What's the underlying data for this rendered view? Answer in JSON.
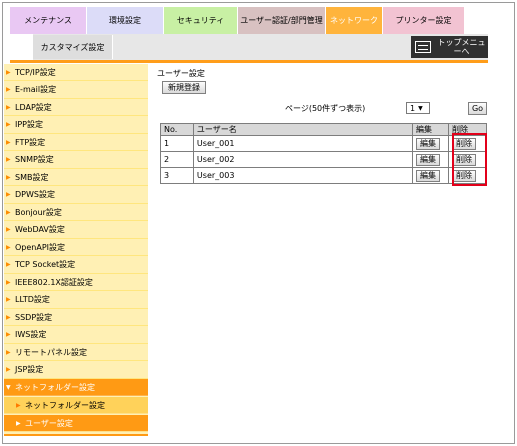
{
  "tabs": {
    "maintenance": "メンテナンス",
    "environment": "環境設定",
    "security": "セキュリティ",
    "auth": "ユーザー認証/部門管理",
    "network": "ネットワーク",
    "printer": "プリンター設定",
    "customize": "カスタマイズ設定"
  },
  "top_menu": {
    "label": "トップメニューへ",
    "icon": "menu-list-icon"
  },
  "sidebar": {
    "items": [
      {
        "label": "TCP/IP設定"
      },
      {
        "label": "E-mail設定"
      },
      {
        "label": "LDAP設定"
      },
      {
        "label": "IPP設定"
      },
      {
        "label": "FTP設定"
      },
      {
        "label": "SNMP設定"
      },
      {
        "label": "SMB設定"
      },
      {
        "label": "DPWS設定"
      },
      {
        "label": "Bonjour設定"
      },
      {
        "label": "WebDAV設定"
      },
      {
        "label": "OpenAPI設定"
      },
      {
        "label": "TCP Socket設定"
      },
      {
        "label": "IEEE802.1X認証設定"
      },
      {
        "label": "LLTD設定"
      },
      {
        "label": "SSDP設定"
      },
      {
        "label": "IWS設定"
      },
      {
        "label": "リモートパネル設定"
      },
      {
        "label": "JSP設定"
      }
    ],
    "group": {
      "label": "ネットフォルダー設定"
    },
    "sub_items": [
      {
        "label": "ネットフォルダー設定"
      },
      {
        "label": "ユーザー設定"
      }
    ]
  },
  "main": {
    "title": "ユーザー設定",
    "register_button": "新規登録",
    "pager_label": "ページ(50件ずつ表示)",
    "page_select": "1",
    "go_button": "Go",
    "table": {
      "headers": [
        "No.",
        "ユーザー名",
        "編集",
        "削除"
      ],
      "rows": [
        {
          "no": "1",
          "name": "User_001",
          "edit": "編集",
          "delete": "削除"
        },
        {
          "no": "2",
          "name": "User_002",
          "edit": "編集",
          "delete": "削除"
        },
        {
          "no": "3",
          "name": "User_003",
          "edit": "編集",
          "delete": "削除"
        }
      ]
    }
  },
  "colors": {
    "accent": "#ff9a14",
    "sidebar_bg": "#fff0b4",
    "highlight": "#e2001a"
  }
}
